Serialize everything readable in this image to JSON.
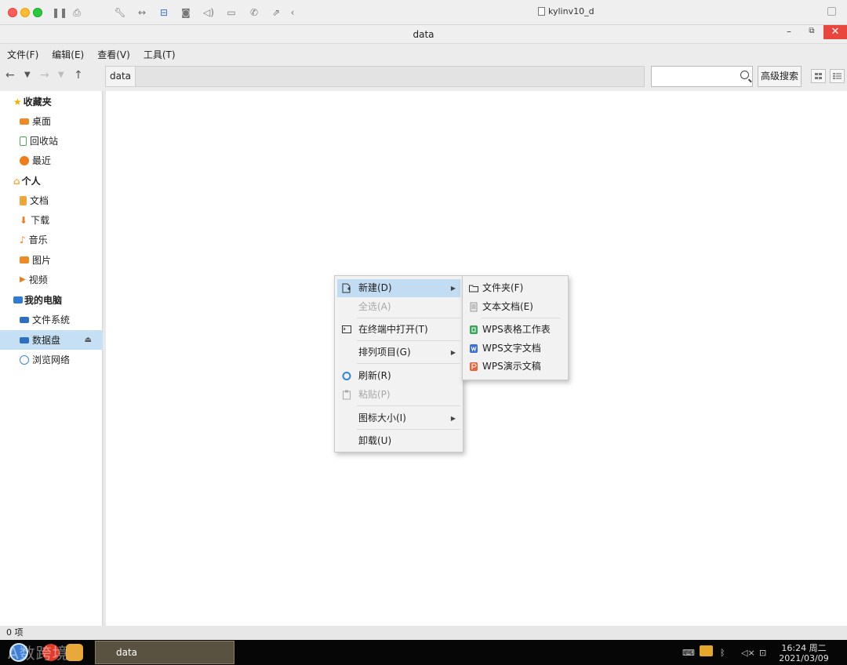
{
  "host": {
    "vm_title": "kylinv10_d"
  },
  "window": {
    "title": "data"
  },
  "menubar": {
    "items": [
      "文件(F)",
      "编辑(E)",
      "查看(V)",
      "工具(T)"
    ]
  },
  "toolbar": {
    "breadcrumb": [
      "data"
    ],
    "search_value": "",
    "advanced_search_label": "高级搜索"
  },
  "sidebar": {
    "sections": [
      {
        "label": "收藏夹",
        "items": [
          "桌面",
          "回收站",
          "最近"
        ]
      },
      {
        "label": "个人",
        "items": [
          "文档",
          "下载",
          "音乐",
          "图片",
          "视频"
        ]
      },
      {
        "label": "我的电脑",
        "items": [
          "文件系统",
          "数据盘",
          "浏览网络"
        ],
        "selected": "数据盘"
      }
    ]
  },
  "context_menu": {
    "items": [
      "新建(D)",
      "全选(A)",
      "在终端中打开(T)",
      "排列项目(G)",
      "刷新(R)",
      "粘贴(P)",
      "图标大小(I)",
      "卸载(U)"
    ],
    "disabled": [
      "全选(A)",
      "粘贴(P)"
    ],
    "highlighted": "新建(D)"
  },
  "submenu_new": {
    "items": [
      "文件夹(F)",
      "文本文档(E)",
      "WPS表格工作表",
      "WPS文字文档",
      "WPS演示文稿"
    ]
  },
  "statusbar": {
    "text": "0 项"
  },
  "taskbar": {
    "task_label": "data",
    "time": "16:24 周二",
    "date": "2021/03/09",
    "watermark": "A数跨境"
  },
  "colors": {
    "selection": "#c5dff4",
    "menu_highlight": "#c2dcf3",
    "close_button": "#e9473d",
    "taskbar_bg": "#060606"
  }
}
